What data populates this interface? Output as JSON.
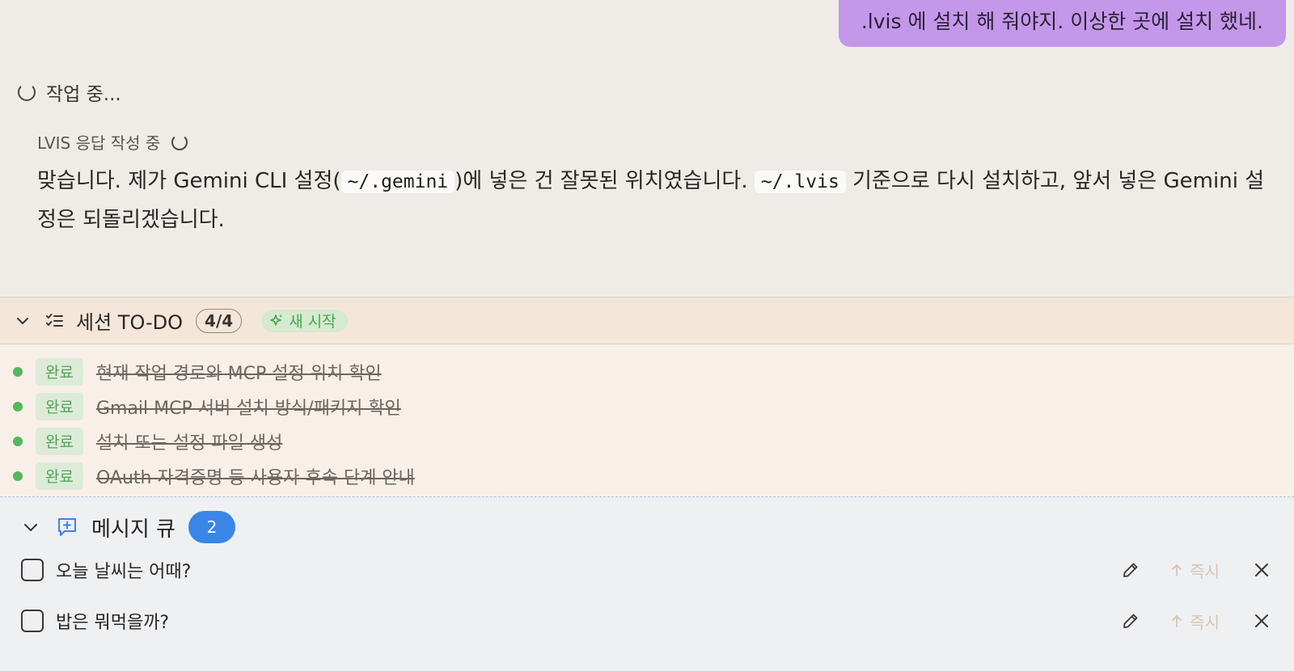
{
  "chat": {
    "user_message": ".lvis 에 설치 해 줘야지. 이상한 곳에 설치 했네.",
    "working_status": "작업 중...",
    "response_status": "LVIS 응답 작성 중",
    "response": {
      "part1": "맞습니다. 제가 Gemini CLI 설정(",
      "code1": "~/.gemini",
      "part2": ")에 넣은 건 잘못된 위치였습니다. ",
      "code2": "~/.lvis",
      "part3": " 기준으로 다시 설치하고, 앞서 넣은 Gemini 설정은 되돌리겠습니다."
    }
  },
  "todo": {
    "title": "세션 TO-DO",
    "count": "4/4",
    "new_start_label": "새 시작",
    "items": [
      {
        "status": "완료",
        "text": "현재 작업 경로와 MCP 설정 위치 확인"
      },
      {
        "status": "완료",
        "text": "Gmail MCP 서버 설치 방식/패키지 확인"
      },
      {
        "status": "완료",
        "text": "설치 또는 설정 파일 생성"
      },
      {
        "status": "완료",
        "text": "OAuth 자격증명 등 사용자 후속 단계 안내"
      }
    ]
  },
  "queue": {
    "title": "메시지 큐",
    "count": "2",
    "immediate_label": "즉시",
    "items": [
      {
        "text": "오늘 날씨는 어때?"
      },
      {
        "text": "밥은 뭐먹을까?"
      }
    ]
  },
  "colors": {
    "user_bubble": "#c397ea",
    "done_green": "#52b85c",
    "queue_badge": "#3a85e8",
    "todo_header_bg": "#f4e7da",
    "queue_bg": "#eff0f2"
  }
}
